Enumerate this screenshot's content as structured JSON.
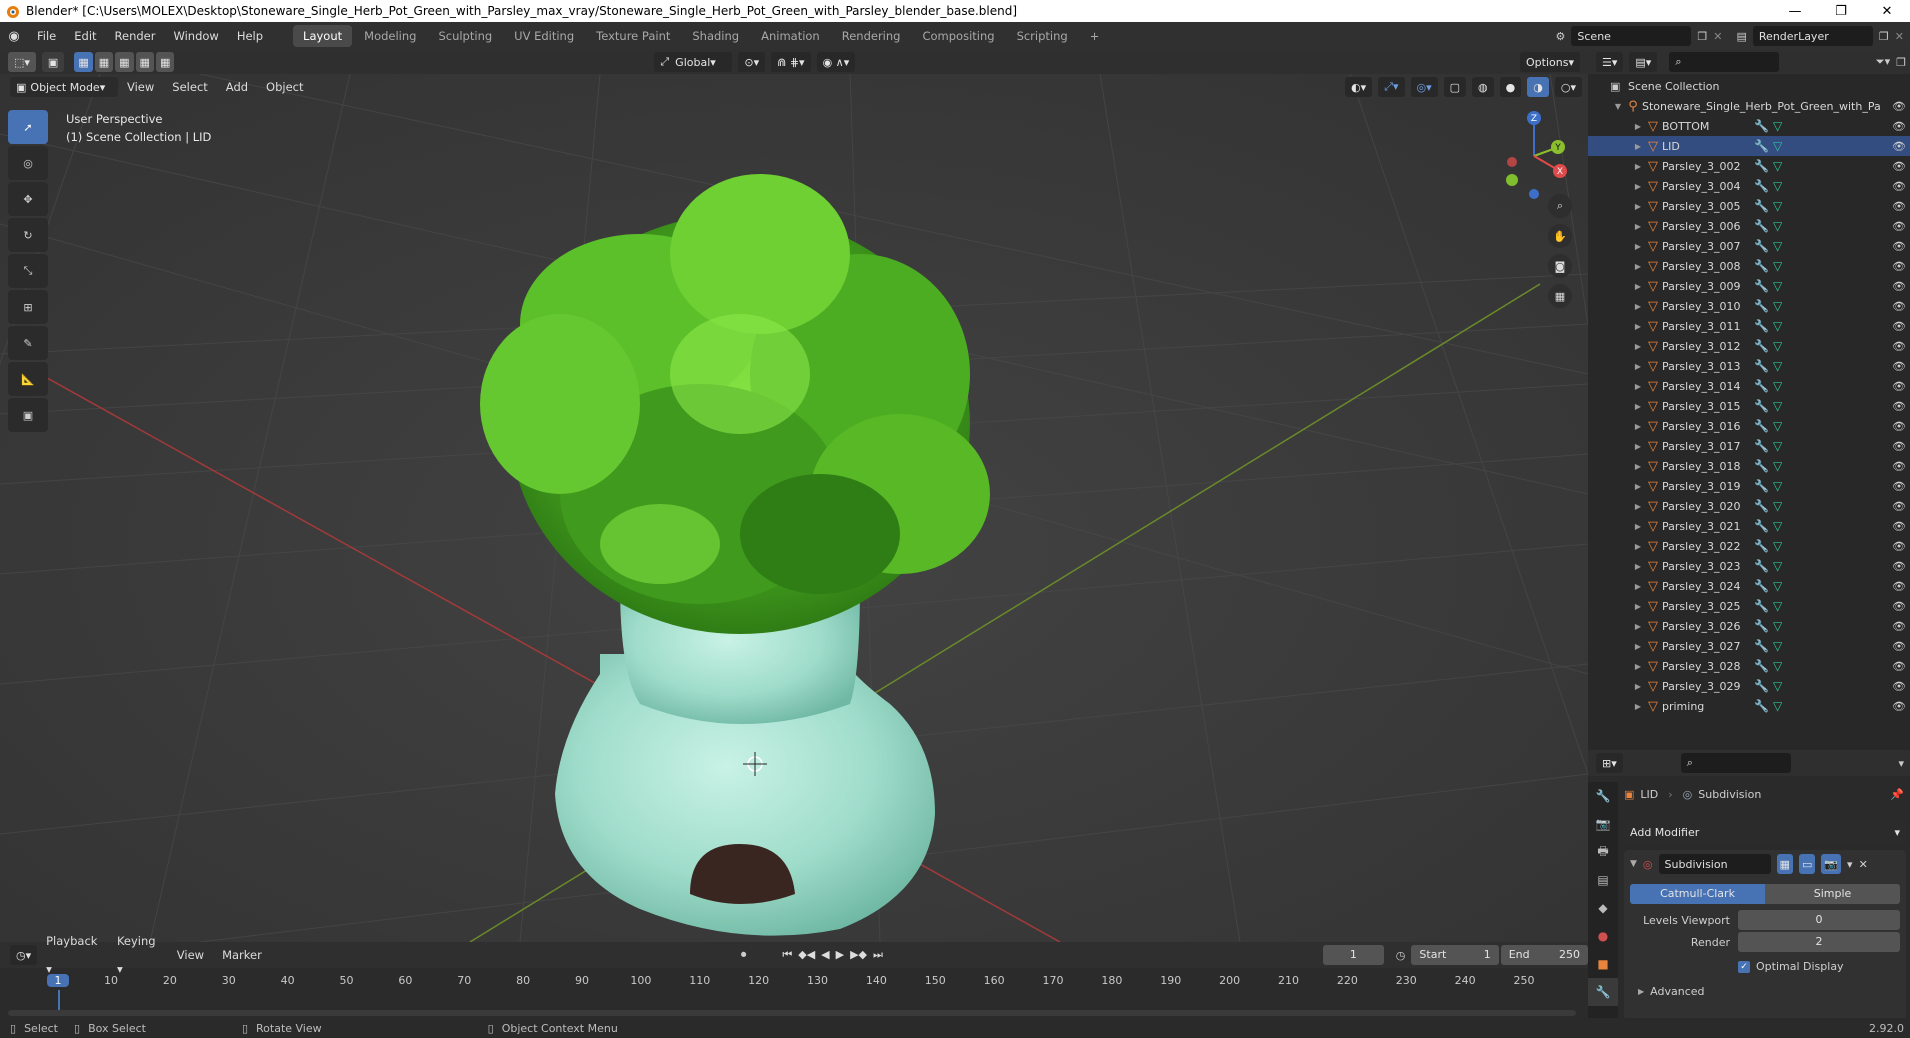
{
  "window": {
    "title": "Blender* [C:\\Users\\MOLEX\\Desktop\\Stoneware_Single_Herb_Pot_Green_with_Parsley_max_vray/Stoneware_Single_Herb_Pot_Green_with_Parsley_blender_base.blend]",
    "minimize": "—",
    "maximize": "❐",
    "close": "✕"
  },
  "menu": [
    "File",
    "Edit",
    "Render",
    "Window",
    "Help"
  ],
  "workspaces": [
    "Layout",
    "Modeling",
    "Sculpting",
    "UV Editing",
    "Texture Paint",
    "Shading",
    "Animation",
    "Rendering",
    "Compositing",
    "Scripting"
  ],
  "workspace_add": "+",
  "scene": {
    "label": "Scene",
    "render_layer": "RenderLayer"
  },
  "viewport_header": {
    "mode": "Object Mode",
    "menus": [
      "View",
      "Select",
      "Add",
      "Object"
    ],
    "orientation": "Global",
    "options": "Options"
  },
  "viewport": {
    "perspective": "User Perspective",
    "collection_info": "(1) Scene Collection | LID",
    "gizmo": {
      "z": "Z",
      "y": "Y",
      "x": "X"
    }
  },
  "outliner": {
    "root": "Scene Collection",
    "collection": "Stoneware_Single_Herb_Pot_Green_with_Pa",
    "items": [
      "BOTTOM",
      "LID",
      "Parsley_3_002",
      "Parsley_3_004",
      "Parsley_3_005",
      "Parsley_3_006",
      "Parsley_3_007",
      "Parsley_3_008",
      "Parsley_3_009",
      "Parsley_3_010",
      "Parsley_3_011",
      "Parsley_3_012",
      "Parsley_3_013",
      "Parsley_3_014",
      "Parsley_3_015",
      "Parsley_3_016",
      "Parsley_3_017",
      "Parsley_3_018",
      "Parsley_3_019",
      "Parsley_3_020",
      "Parsley_3_021",
      "Parsley_3_022",
      "Parsley_3_023",
      "Parsley_3_024",
      "Parsley_3_025",
      "Parsley_3_026",
      "Parsley_3_027",
      "Parsley_3_028",
      "Parsley_3_029",
      "priming"
    ],
    "selected": "LID"
  },
  "properties": {
    "object": "LID",
    "modifier_crumb": "Subdivision",
    "add_modifier": "Add Modifier",
    "modifier_name": "Subdivision",
    "mode_a": "Catmull-Clark",
    "mode_b": "Simple",
    "levels_viewport_label": "Levels Viewport",
    "levels_viewport": "0",
    "render_label": "Render",
    "render": "2",
    "optimal_display": "Optimal Display",
    "advanced": "Advanced"
  },
  "timeline": {
    "menus": [
      "Playback",
      "Keying",
      "View",
      "Marker"
    ],
    "current_frame": "1",
    "start_label": "Start",
    "start": "1",
    "end_label": "End",
    "end": "250",
    "ticks": [
      "1",
      "10",
      "20",
      "30",
      "40",
      "50",
      "60",
      "70",
      "80",
      "90",
      "100",
      "110",
      "120",
      "130",
      "140",
      "150",
      "160",
      "170",
      "180",
      "190",
      "200",
      "210",
      "220",
      "230",
      "240",
      "250"
    ]
  },
  "statusbar": {
    "select": "Select",
    "box_select": "Box Select",
    "rotate_view": "Rotate View",
    "context_menu": "Object Context Menu",
    "version": "2.92.0"
  },
  "colors": {
    "accent": "#4772b3",
    "mesh_icon": "#e8843c",
    "pot": "#a9e3d2",
    "foliage": "#5fbf2a"
  }
}
